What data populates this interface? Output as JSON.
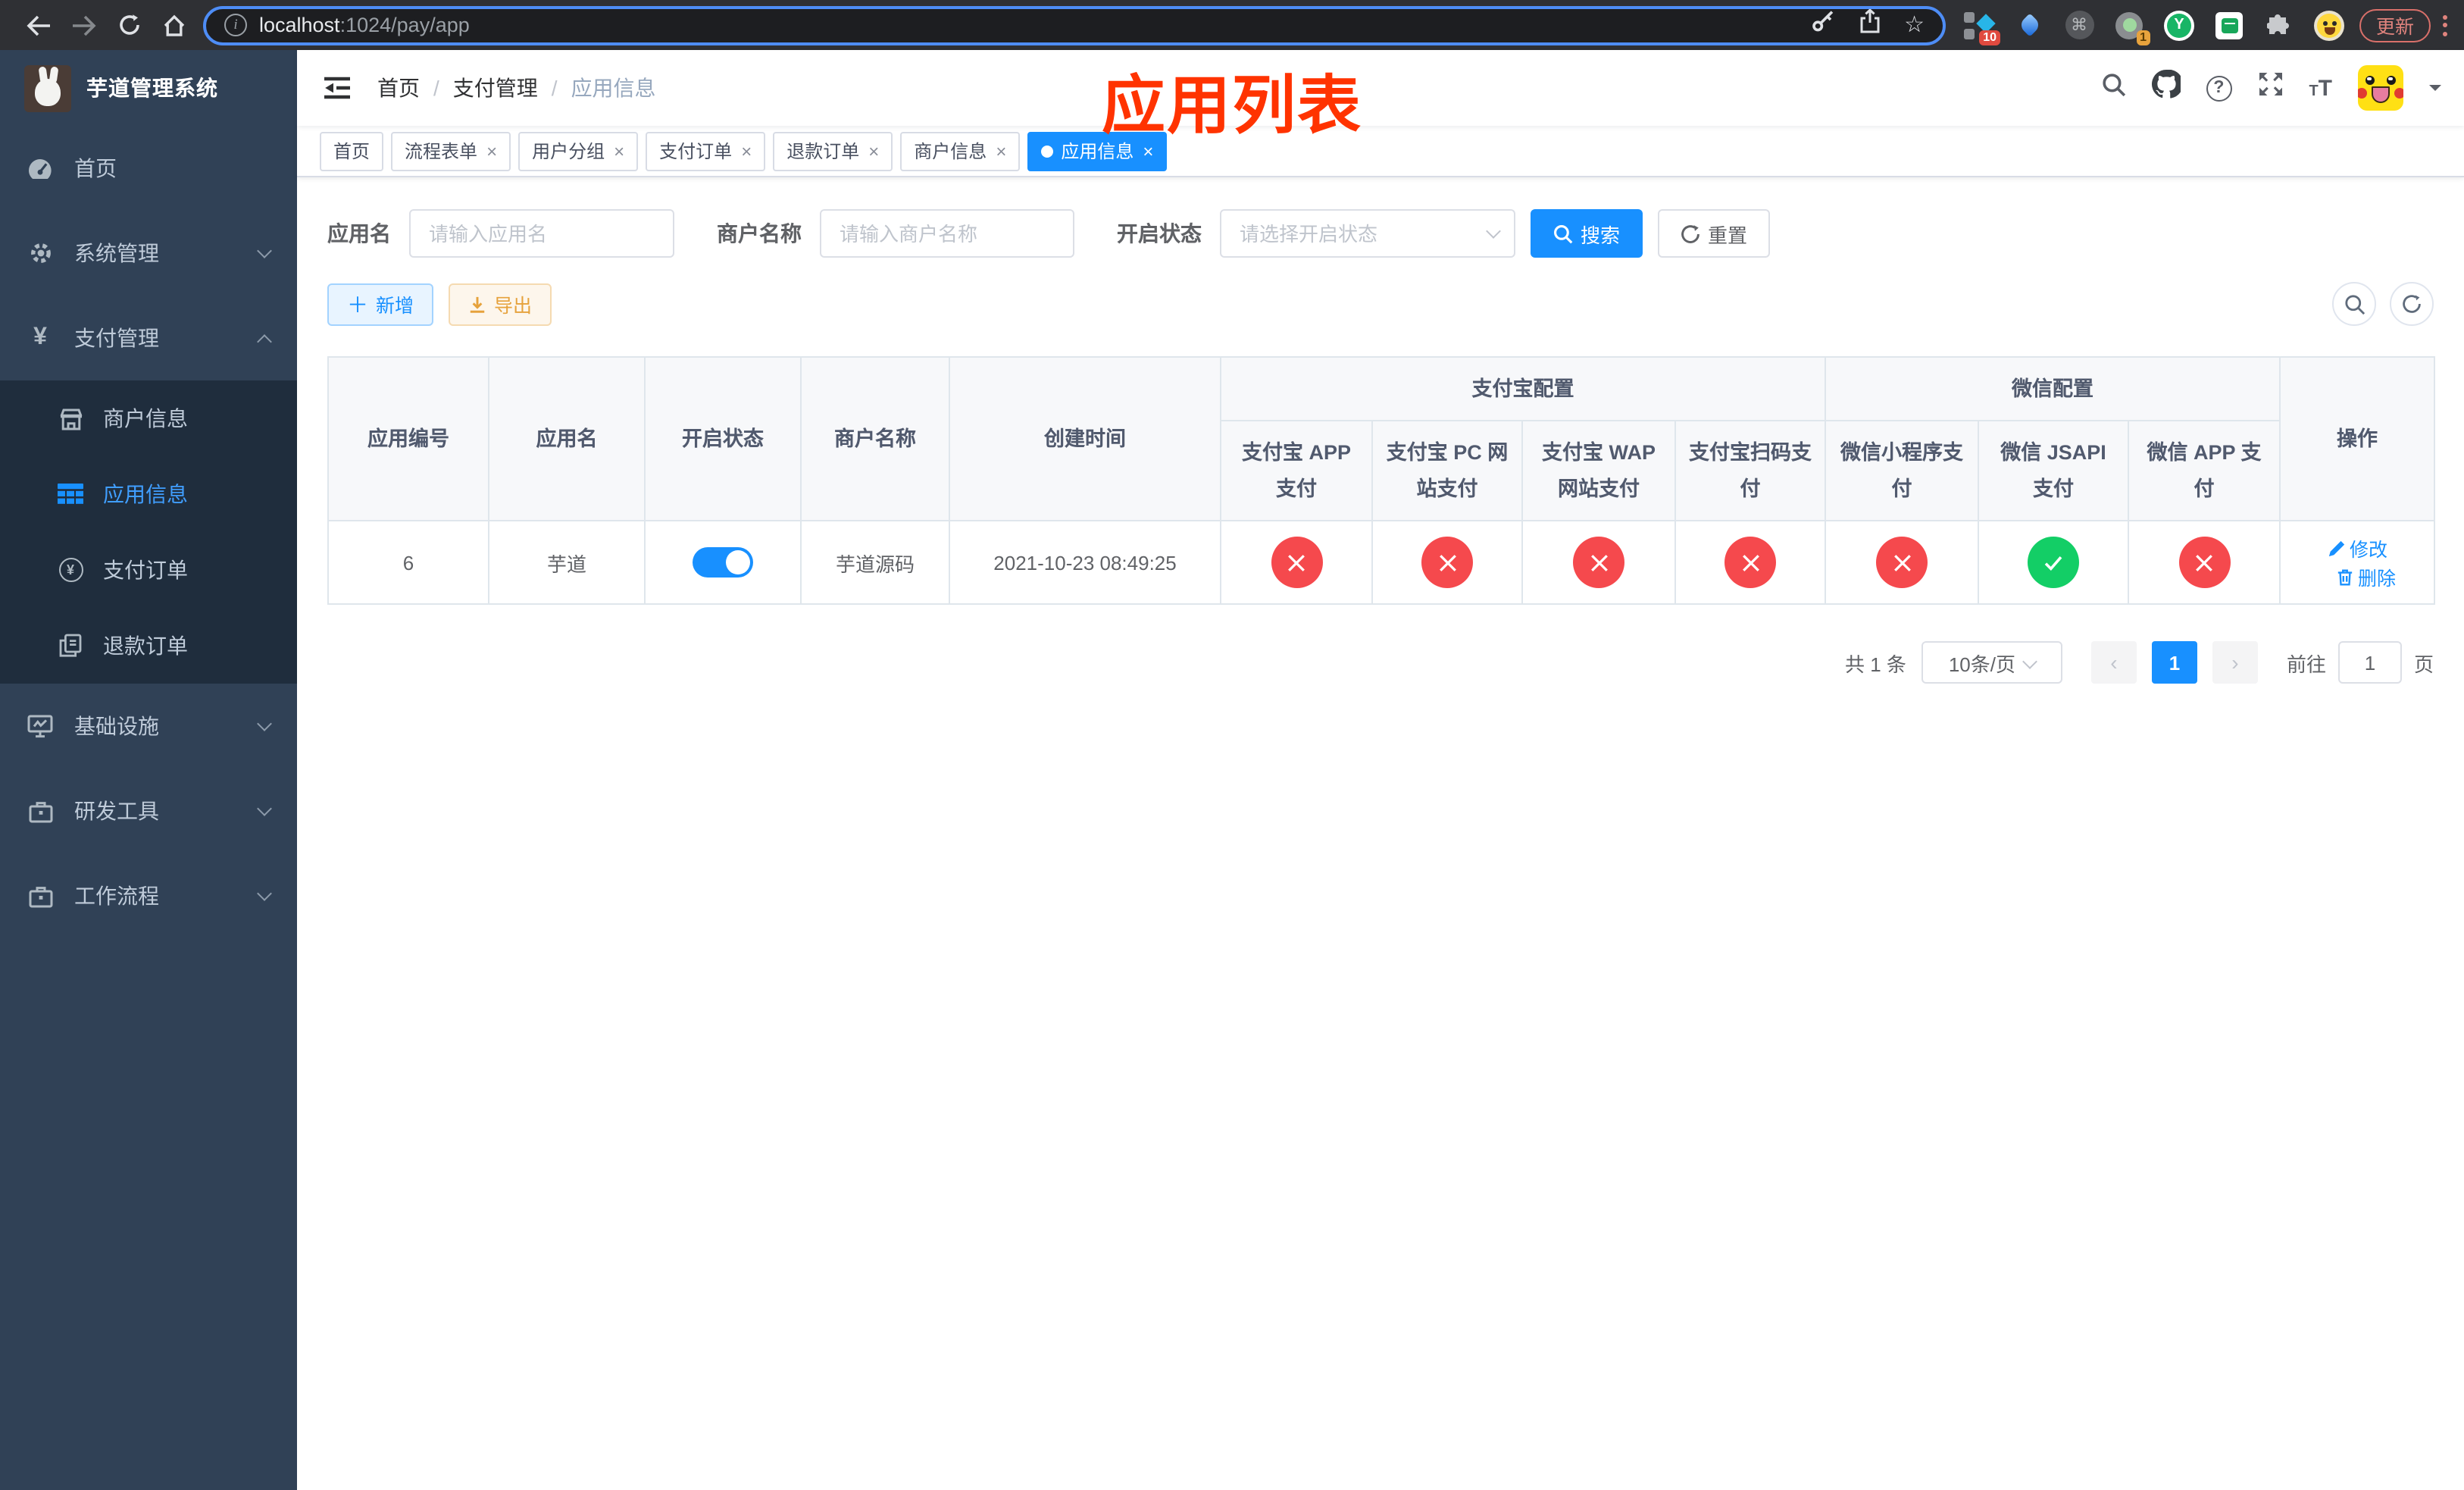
{
  "browser": {
    "url": {
      "host": "localhost",
      "rest": ":1024/pay/app"
    },
    "update_button": "更新",
    "extensions": {
      "pin_badge": "10",
      "tab_badge": "1",
      "letter": "Y"
    }
  },
  "colors": {
    "accent": "#1890ff",
    "danger": "#f5494d",
    "success": "#13ce66",
    "sidebar_bg": "#304156",
    "submenu_bg": "#1f2d3d",
    "warning": "#e6a23c",
    "annotation_red": "#ff3300"
  },
  "sidebar": {
    "title": "芋道管理系统",
    "menu_top": [
      {
        "label": "首页",
        "icon": "dashboard-icon"
      },
      {
        "label": "系统管理",
        "icon": "gear-icon"
      },
      {
        "label": "支付管理",
        "icon": "yen-icon"
      }
    ],
    "submenu": [
      {
        "label": "商户信息",
        "icon": "shop-icon"
      },
      {
        "label": "应用信息",
        "icon": "grid-icon"
      },
      {
        "label": "支付订单",
        "icon": "pay-order-icon"
      },
      {
        "label": "退款订单",
        "icon": "refund-icon"
      }
    ],
    "menu_bottom": [
      {
        "label": "基础设施",
        "icon": "monitor-icon"
      },
      {
        "label": "研发工具",
        "icon": "toolbox-icon"
      },
      {
        "label": "工作流程",
        "icon": "workflow-icon"
      }
    ]
  },
  "navbar": {
    "breadcrumb": [
      "首页",
      "支付管理",
      "应用信息"
    ],
    "annotation": "应用列表"
  },
  "tags": {
    "items": [
      {
        "label": "首页"
      },
      {
        "label": "流程表单"
      },
      {
        "label": "用户分组"
      },
      {
        "label": "支付订单"
      },
      {
        "label": "退款订单"
      },
      {
        "label": "商户信息"
      },
      {
        "label": "应用信息"
      }
    ]
  },
  "search": {
    "fields": [
      {
        "label": "应用名",
        "placeholder": "请输入应用名"
      },
      {
        "label": "商户名称",
        "placeholder": "请输入商户名称"
      },
      {
        "label": "开启状态",
        "placeholder": "请选择开启状态"
      }
    ],
    "search_label": "搜索",
    "reset_label": "重置"
  },
  "toolbar": {
    "add_label": "新增",
    "export_label": "导出"
  },
  "table": {
    "groups": [
      {
        "label": "支付宝配置"
      },
      {
        "label": "微信配置"
      }
    ],
    "columns": [
      "应用编号",
      "应用名",
      "开启状态",
      "商户名称",
      "创建时间",
      "支付宝 APP 支付",
      "支付宝 PC 网站支付",
      "支付宝 WAP 网站支付",
      "支付宝扫码支付",
      "微信小程序支付",
      "微信 JSAPI 支付",
      "微信 APP 支付",
      "操作"
    ],
    "rows": [
      {
        "id": "6",
        "name": "芋道",
        "enabled": true,
        "merchant": "芋道源码",
        "created": "2021-10-23 08:49:25",
        "statuses": [
          "no",
          "no",
          "no",
          "no",
          "no",
          "yes",
          "no"
        ],
        "edit_label": "修改",
        "delete_label": "删除"
      }
    ]
  },
  "pagination": {
    "total": "共 1 条",
    "page_size": "10条/页",
    "current_page": "1",
    "goto_label": "前往",
    "goto_value": "1",
    "page_unit": "页"
  }
}
